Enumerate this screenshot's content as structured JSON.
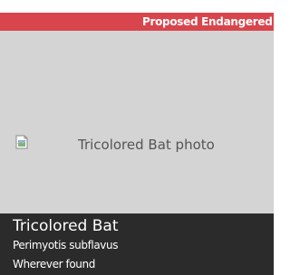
{
  "status": {
    "label": "Proposed Endangered",
    "color": "#d9454d"
  },
  "photo": {
    "alt_text": "Tricolored Bat photo",
    "icon": "broken-image-icon"
  },
  "species": {
    "common_name": "Tricolored Bat",
    "scientific_name": "Perimyotis subflavus",
    "range": "Wherever found"
  }
}
